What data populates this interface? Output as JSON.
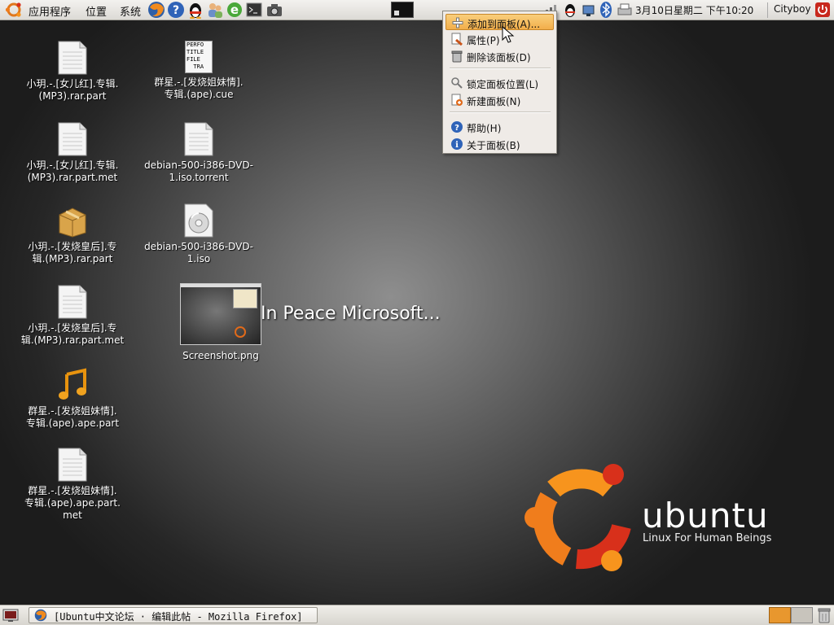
{
  "top_panel": {
    "menus": [
      "应用程序",
      "位置",
      "系统"
    ],
    "clock": "3月10日星期二  下午10:20",
    "user": "Cityboy"
  },
  "context_menu": {
    "items": [
      {
        "label": "添加到面板(A)...",
        "icon": "add-icon"
      },
      {
        "label": "属性(P)",
        "icon": "properties-icon"
      },
      {
        "label": "删除该面板(D)",
        "icon": "trash-icon"
      },
      {
        "label": "锁定面板位置(L)",
        "icon": "lock-icon"
      },
      {
        "label": "新建面板(N)",
        "icon": "new-panel-icon"
      },
      {
        "label": "帮助(H)",
        "icon": "help-icon"
      },
      {
        "label": "关于面板(B)",
        "icon": "about-icon"
      }
    ]
  },
  "desktop": {
    "icons": [
      {
        "label": "小玥.-.[女儿红].专辑.\n(MP3).rar.part",
        "icon": "document-icon"
      },
      {
        "label": "小玥.-.[女儿红].专辑.\n(MP3).rar.part.met",
        "icon": "document-icon"
      },
      {
        "label": "小玥.-.[发烧皇后].专\n辑.(MP3).rar.part",
        "icon": "package-icon"
      },
      {
        "label": "小玥.-.[发烧皇后].专\n辑.(MP3).rar.part.met",
        "icon": "document-icon"
      },
      {
        "label": "群星.-.[发烧姐妹情].\n专辑.(ape).ape.part",
        "icon": "music-note-icon"
      },
      {
        "label": "群星.-.[发烧姐妹情].\n专辑.(ape).ape.part.\nmet",
        "icon": "document-icon"
      },
      {
        "label": "群星.-.[发烧姐妹情].\n专辑.(ape).cue",
        "icon": "cue-file-icon",
        "icon_text": "PERFO\nTITLE\nFILE\n  TRA"
      },
      {
        "label": "debian-500-i386-DVD-\n1.iso.torrent",
        "icon": "document-icon"
      },
      {
        "label": "debian-500-i386-DVD-\n1.iso",
        "icon": "disc-image-icon"
      },
      {
        "label": "Screenshot.png",
        "icon": "image-thumbnail-icon"
      }
    ],
    "overlay_text": "In Peace Microsoft...",
    "brand": {
      "wordmark": "ubuntu",
      "tagline": "Linux For Human Beings"
    }
  },
  "bottom_panel": {
    "task_title": "[Ubuntu中文论坛 · 编辑此帖 - Mozilla Firefox]"
  },
  "colors": {
    "ubuntu_orange": "#f07d1c",
    "ubuntu_red": "#d8301b",
    "menu_highlight": "#f2ae4a"
  }
}
